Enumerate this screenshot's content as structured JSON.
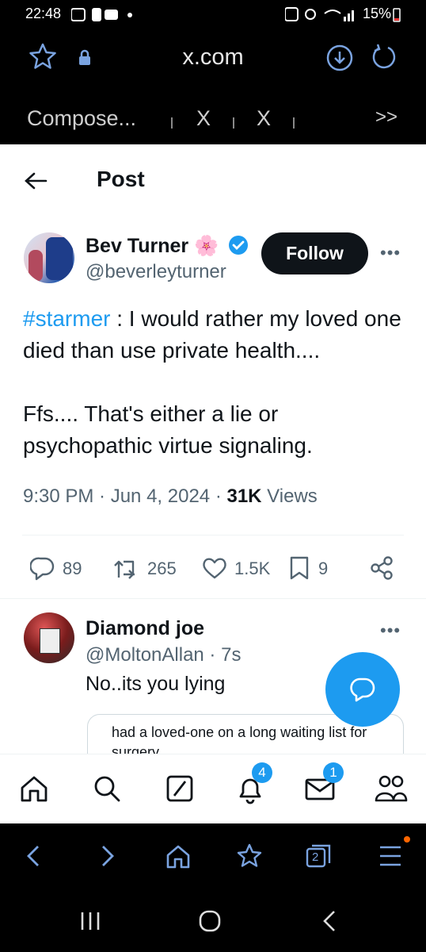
{
  "status_bar": {
    "time": "22:48",
    "battery": "15%"
  },
  "browser": {
    "url": "x.com",
    "tabs": [
      "Compose...",
      "X",
      "X"
    ],
    "more_tabs": ">>",
    "tab_count": "2"
  },
  "page": {
    "back_label": "←",
    "title": "Post"
  },
  "tweet": {
    "author_name": "Bev Turner",
    "author_emoji": "🌸",
    "author_handle": "@beverleyturner",
    "follow_label": "Follow",
    "more_label": "•••",
    "hashtag": "#starmer",
    "line1_rest": " : I would rather my loved one died than use private health....",
    "line2": "Ffs.... That's either a lie or psychopathic virtue signaling.",
    "timestamp": "9:30 PM · Jun 4, 2024 · ",
    "views_count": "31K",
    "views_label": " Views",
    "replies": "89",
    "reposts": "265",
    "likes": "1.5K",
    "bookmarks": "9"
  },
  "reply": {
    "author_name": "Diamond joe",
    "handle_time": "@MoltonAllan · 7s",
    "text": "No..its you lying",
    "quote_text": "had a loved-one on a long waiting list for surgery",
    "more_label": "•••"
  },
  "bottom_nav": {
    "notifications_badge": "4",
    "messages_badge": "1"
  },
  "colors": {
    "accent": "#1d9bf0",
    "text": "#0f1419",
    "secondary": "#536471"
  }
}
